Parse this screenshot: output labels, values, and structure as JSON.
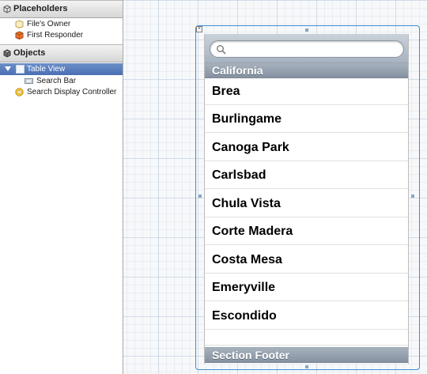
{
  "outline": {
    "placeholders": {
      "title": "Placeholders",
      "items": [
        {
          "label": "File's Owner",
          "icon": "cube-icon"
        },
        {
          "label": "First Responder",
          "icon": "first-responder-icon"
        }
      ]
    },
    "objects": {
      "title": "Objects",
      "items": [
        {
          "label": "Table View",
          "icon": "table-view-icon",
          "selected": true,
          "expanded": true
        },
        {
          "label": "Search Bar",
          "icon": "search-bar-icon",
          "indent": 1
        },
        {
          "label": "Search Display Controller",
          "icon": "search-display-controller-icon"
        }
      ]
    }
  },
  "table_view": {
    "search_placeholder": "",
    "section_header": "California",
    "rows": [
      "Brea",
      "Burlingame",
      "Canoga Park",
      "Carlsbad",
      "Chula Vista",
      "Corte Madera",
      "Costa Mesa",
      "Emeryville",
      "Escondido"
    ],
    "section_footer": "Section Footer"
  },
  "colors": {
    "selection": "#4a6fb3",
    "frame_border": "#3f8fd6",
    "section_bar": "#8592a1"
  }
}
